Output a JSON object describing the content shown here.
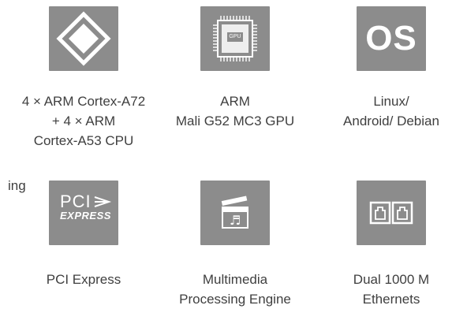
{
  "partial_text": "ing",
  "features": [
    {
      "icon": "cpu-diamond-icon",
      "label": "4 × ARM Cortex-A72\n+ 4 × ARM\nCortex-A53 CPU"
    },
    {
      "icon": "gpu-chip-icon",
      "label": "ARM\nMali G52 MC3 GPU",
      "chip_text": "GPU"
    },
    {
      "icon": "os-icon",
      "label": "Linux/\nAndroid/ Debian",
      "logo_text": "OS"
    },
    {
      "icon": "pci-express-icon",
      "label": "PCI Express",
      "logo_top": "PCI",
      "logo_bottom": "EXPRESS"
    },
    {
      "icon": "multimedia-clapper-icon",
      "label": "Multimedia\nProcessing Engine"
    },
    {
      "icon": "dual-ethernet-icon",
      "label": "Dual 1000 M\nEthernets"
    }
  ],
  "colors": {
    "tile": "#8c8c8c",
    "text": "#3f3f3f",
    "icon": "#ffffff"
  }
}
